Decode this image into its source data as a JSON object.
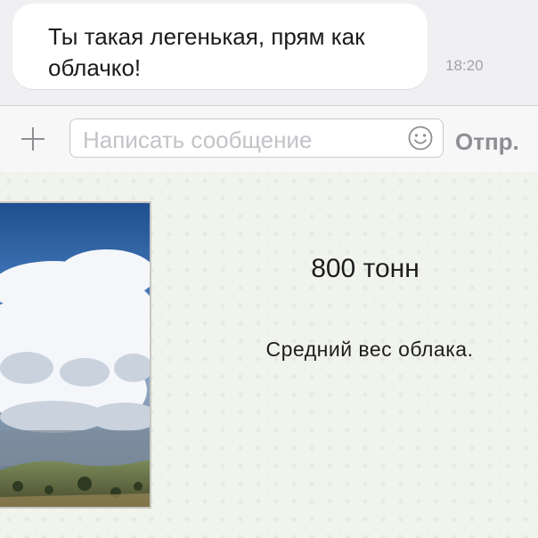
{
  "message": {
    "text": "Ты такая легенькая, прям как облачко!",
    "time": "18:20"
  },
  "composer": {
    "placeholder": "Написать сообщение",
    "send_label": "Отпр.",
    "icons": {
      "attach": "plus-icon",
      "emoji": "smiley-icon"
    }
  },
  "fact_card": {
    "value": "800 тонн",
    "description": "Средний вес облака."
  },
  "colors": {
    "chat_background": "#f0f0f3",
    "bubble": "#ffffff",
    "timestamp": "#a3a3a8",
    "send_label": "#8e8e93",
    "card_background": "#f1f4ed"
  }
}
